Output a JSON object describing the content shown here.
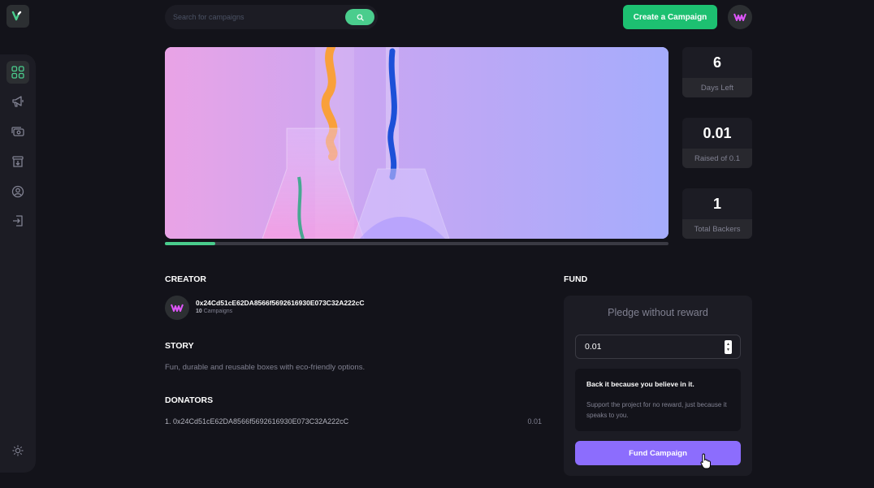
{
  "search": {
    "placeholder": "Search for campaigns"
  },
  "header": {
    "create_label": "Create a Campaign"
  },
  "sidebar": {
    "items": [
      {
        "icon": "dashboard-icon",
        "active": true
      },
      {
        "icon": "campaign-icon"
      },
      {
        "icon": "payment-icon"
      },
      {
        "icon": "withdraw-icon"
      },
      {
        "icon": "profile-icon"
      },
      {
        "icon": "logout-icon"
      }
    ],
    "theme_icon": "sun-icon"
  },
  "campaign": {
    "progress_fraction": 0.1
  },
  "stats": [
    {
      "value": "6",
      "label": "Days Left"
    },
    {
      "value": "0.01",
      "label": "Raised of 0.1"
    },
    {
      "value": "1",
      "label": "Total Backers"
    }
  ],
  "creator": {
    "heading": "Creator",
    "address": "0x24Cd51cE62DA8566f5692616930E073C32A222cC",
    "campaign_count": "10",
    "campaign_suffix": "Campaigns"
  },
  "story": {
    "heading": "Story",
    "text": "Fun, durable and reusable boxes with eco-friendly options."
  },
  "donators": {
    "heading": "Donators",
    "rows": [
      {
        "label": "1. 0x24Cd51cE62DA8566f5692616930E073C32A222cC",
        "amount": "0.01"
      }
    ]
  },
  "fund": {
    "heading": "Fund",
    "pledge_title": "Pledge without reward",
    "amount_value": "0.01",
    "believe_title": "Back it because you believe in it.",
    "believe_text": "Support the project for no reward, just because it speaks to you.",
    "button_label": "Fund Campaign"
  },
  "colors": {
    "accent": "#1dc071",
    "progress": "#4acd8d",
    "fund_button": "#8c6dfd",
    "background": "#13131a",
    "panel": "#1c1c24"
  }
}
